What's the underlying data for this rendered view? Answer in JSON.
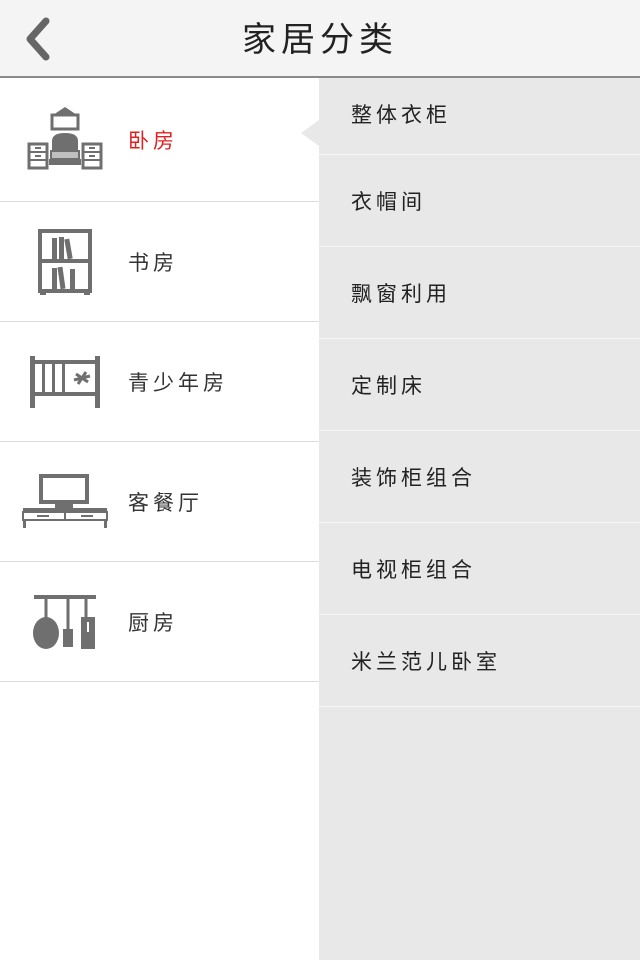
{
  "header": {
    "title": "家居分类",
    "back_icon": "chevron-left-icon"
  },
  "categories": [
    {
      "label": "卧房",
      "icon": "bedroom-icon",
      "selected": true
    },
    {
      "label": "书房",
      "icon": "bookshelf-icon",
      "selected": false
    },
    {
      "label": "青少年房",
      "icon": "crib-icon",
      "selected": false
    },
    {
      "label": "客餐厅",
      "icon": "tv-cabinet-icon",
      "selected": false
    },
    {
      "label": "厨房",
      "icon": "kitchen-utensils-icon",
      "selected": false
    }
  ],
  "subcategories": [
    {
      "label": "整体衣柜"
    },
    {
      "label": "衣帽间"
    },
    {
      "label": "飘窗利用"
    },
    {
      "label": "定制床"
    },
    {
      "label": "装饰柜组合"
    },
    {
      "label": "电视柜组合"
    },
    {
      "label": "米兰范儿卧室"
    }
  ],
  "colors": {
    "selected_text": "#e02020",
    "icon_gray": "#6f6f6f",
    "right_panel_bg": "#e8e8e8",
    "header_bg": "#f4f4f4"
  }
}
